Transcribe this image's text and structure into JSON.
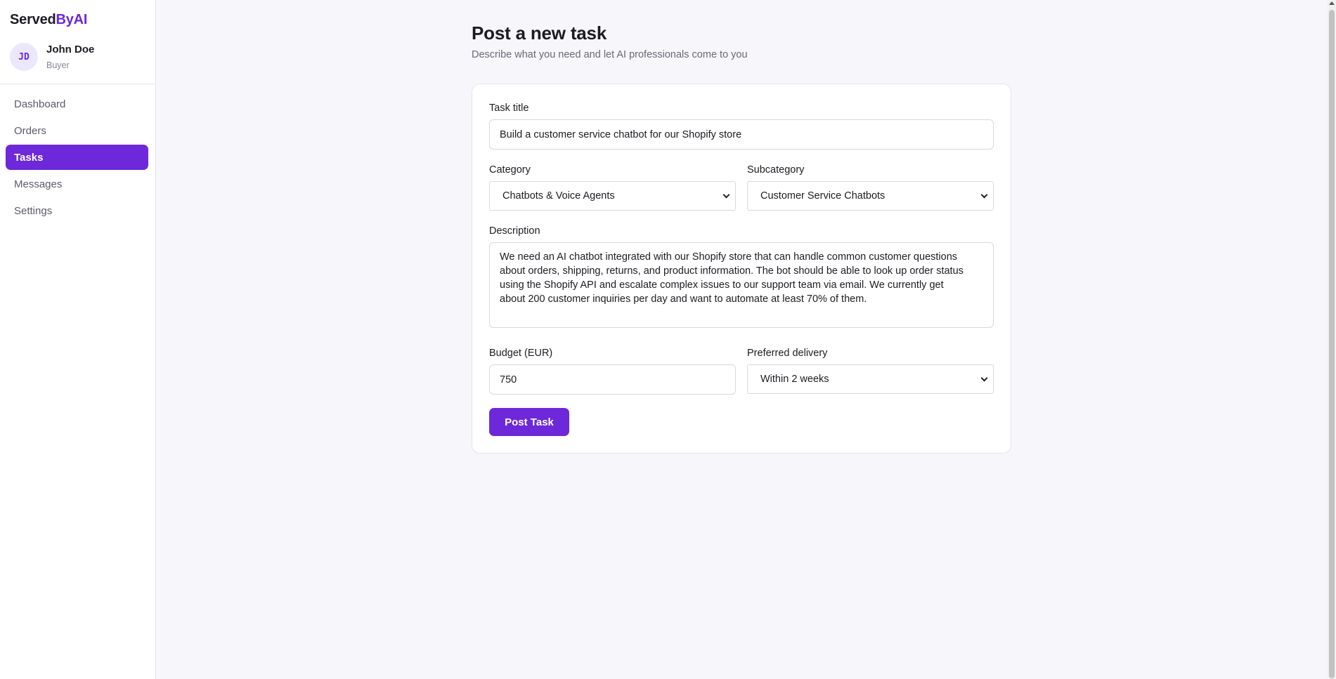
{
  "brand": {
    "name_prefix": "Served",
    "name_accent": "ByAI",
    "accent_color": "#6d28d9"
  },
  "user": {
    "initials": "JD",
    "name": "John Doe",
    "role": "Buyer"
  },
  "sidebar": {
    "items": [
      {
        "label": "Dashboard",
        "active": false
      },
      {
        "label": "Orders",
        "active": false
      },
      {
        "label": "Tasks",
        "active": true
      },
      {
        "label": "Messages",
        "active": false
      },
      {
        "label": "Settings",
        "active": false
      }
    ]
  },
  "page": {
    "title": "Post a new task",
    "subtitle": "Describe what you need and let AI professionals come to you"
  },
  "form": {
    "task_title": {
      "label": "Task title",
      "value": "Build a customer service chatbot for our Shopify store"
    },
    "category": {
      "label": "Category",
      "value": "Chatbots & Voice Agents"
    },
    "subcategory": {
      "label": "Subcategory",
      "value": "Customer Service Chatbots"
    },
    "description": {
      "label": "Description",
      "lines": [
        "We need an AI chatbot integrated with our Shopify store that can handle common customer questions",
        "about orders, shipping, returns, and product information. The bot should be able to look up order status",
        "using the Shopify API and escalate complex issues to our support team via email. We currently get",
        "about 200 customer inquiries per day and want to automate at least 70% of them."
      ]
    },
    "budget": {
      "label": "Budget (EUR)",
      "value": "750"
    },
    "delivery": {
      "label": "Preferred delivery",
      "value": "Within 2 weeks"
    },
    "submit_label": "Post Task"
  }
}
